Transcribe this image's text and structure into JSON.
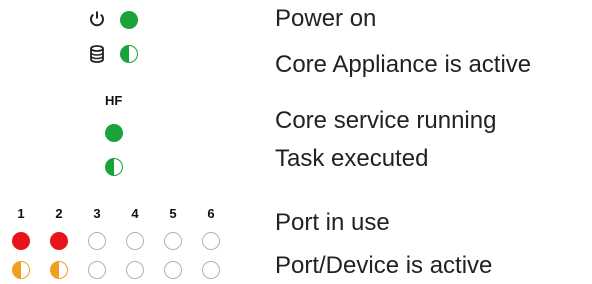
{
  "legend": {
    "power_on": "Power on",
    "appliance_active": "Core Appliance is active",
    "service_running": "Core service running",
    "task_executed": "Task executed",
    "port_in_use": "Port in use",
    "port_device_active": "Port/Device is active"
  },
  "hf_label": "HF",
  "port_numbers": [
    "1",
    "2",
    "3",
    "4",
    "5",
    "6"
  ],
  "icons": {
    "power": "power-icon",
    "appliance": "database-icon"
  },
  "colors": {
    "green": "#1aa33a",
    "red": "#e8141a",
    "orange": "#f0a020",
    "off_outline": "#b3b3b3"
  }
}
